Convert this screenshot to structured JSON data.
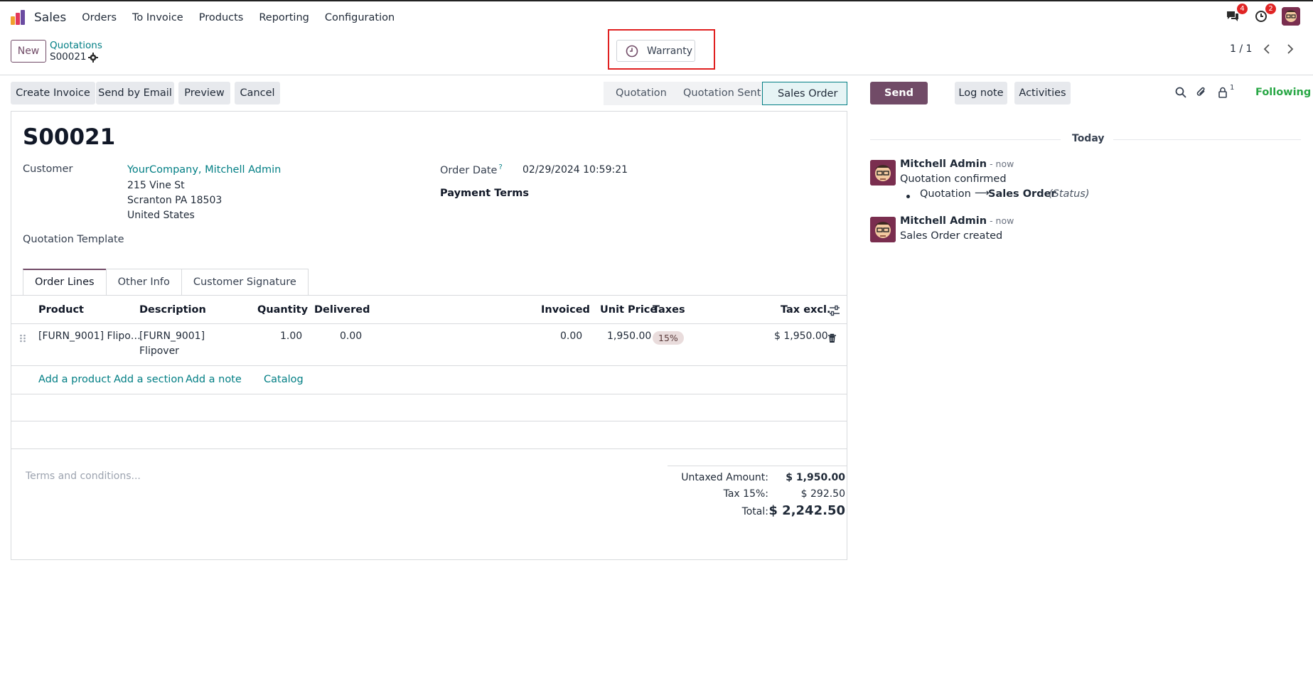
{
  "navbar": {
    "app_title": "Sales",
    "menu": [
      "Orders",
      "To Invoice",
      "Products",
      "Reporting",
      "Configuration"
    ],
    "messages_badge": "4",
    "activities_badge": "2"
  },
  "control_panel": {
    "new_label": "New",
    "breadcrumb_parent": "Quotations",
    "breadcrumb_current": "S00021",
    "smart_button": "Warranty",
    "pager": "1 / 1"
  },
  "actions": {
    "create_invoice": "Create Invoice",
    "send_by_email": "Send by Email",
    "preview": "Preview",
    "cancel": "Cancel"
  },
  "statusbar": {
    "stages": [
      "Quotation",
      "Quotation Sent",
      "Sales Order"
    ],
    "active": "Sales Order"
  },
  "form": {
    "name": "S00021",
    "customer_label": "Customer",
    "customer_name": "YourCompany, Mitchell Admin",
    "address": [
      "215 Vine St",
      "Scranton PA 18503",
      "United States"
    ],
    "quotation_template_label": "Quotation Template",
    "order_date_label": "Order Date",
    "order_date_help": "?",
    "order_date": "02/29/2024 10:59:21",
    "payment_terms_label": "Payment Terms"
  },
  "tabs": [
    "Order Lines",
    "Other Info",
    "Customer Signature"
  ],
  "table": {
    "headers": {
      "product": "Product",
      "description": "Description",
      "quantity": "Quantity",
      "delivered": "Delivered",
      "invoiced": "Invoiced",
      "unit_price": "Unit Price",
      "taxes": "Taxes",
      "tax_excl": "Tax excl."
    },
    "rows": [
      {
        "product": "[FURN_9001] Flipo…",
        "description_line1": "[FURN_9001]",
        "description_line2": "Flipover",
        "quantity": "1.00",
        "delivered": "0.00",
        "invoiced": "0.00",
        "unit_price": "1,950.00",
        "taxes": "15%",
        "subtotal": "$ 1,950.00"
      }
    ],
    "add_links": {
      "product": "Add a product",
      "section": "Add a section",
      "note": "Add a note",
      "catalog": "Catalog"
    }
  },
  "totals": {
    "terms_placeholder": "Terms and conditions...",
    "untaxed_label": "Untaxed Amount:",
    "untaxed_value": "$ 1,950.00",
    "tax_label": "Tax 15%:",
    "tax_value": "$ 292.50",
    "total_label": "Total:",
    "total_value": "$ 2,242.50"
  },
  "chatter": {
    "send_message": "Send message",
    "log_note": "Log note",
    "activities": "Activities",
    "followers_count": "1",
    "following": "Following",
    "date_separator": "Today",
    "messages": [
      {
        "author": "Mitchell Admin",
        "time": "- now",
        "body": "Quotation confirmed",
        "change_from": "Quotation",
        "change_arrow": "⟶",
        "change_to": "Sales Order",
        "change_field": "(Status)"
      },
      {
        "author": "Mitchell Admin",
        "time": "- now",
        "body": "Sales Order created"
      }
    ]
  },
  "colors": {
    "brand": "#714b67",
    "link": "#017e84",
    "following": "#28a745",
    "badge": "#e02424",
    "highlight": "#e02020"
  },
  "icons": [
    "app-logo-icon",
    "chat-icon",
    "clock-icon",
    "user-avatar",
    "gear-icon",
    "chevron-left-icon",
    "chevron-right-icon",
    "clock-icon",
    "drag-handle-icon",
    "trash-icon",
    "column-settings-icon",
    "search-icon",
    "paperclip-icon",
    "lock-icon"
  ]
}
